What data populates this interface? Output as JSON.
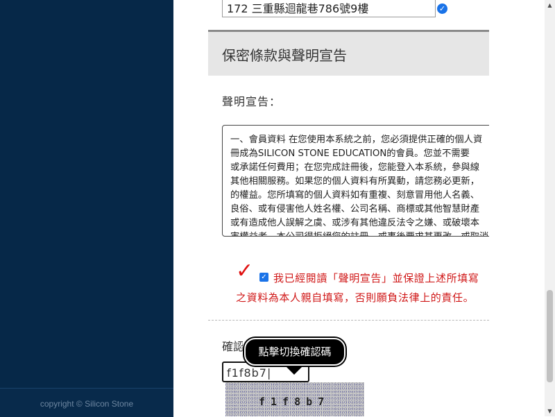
{
  "sidebar": {
    "copyright": "copyright © Silicon Stone"
  },
  "form": {
    "address_value": "172 三重縣迴龍巷786號9樓",
    "address_verified_icon": "check-circle-icon"
  },
  "section": {
    "title": "保密條款與聲明宣告",
    "declaration_label": "聲明宣告："
  },
  "terms": {
    "text_lines": [
      "一、會員資料 在您使用本系統之前，您必須提供正確的個人資",
      "冊成為SILICON STONE EDUCATION的會員。您並不需要",
      "或承諾任何費用；在您完成註冊後，您能登入本系統，參與線",
      "其他相關服務。如果您的個人資料有所異動，請您務必更新，",
      "的權益。您所填寫的個人資料如有重複、刻意冒用他人名義、",
      "良俗、或有侵害他人姓名權、公司名稱、商標或其他智慧財產",
      "或有造成他人誤解之虞、或涉有其他違反法令之嫌、或破壞本",
      "害權益者，本公司得拒絕您的註冊，或事後要求其更改，或取消"
    ]
  },
  "agreement": {
    "checked": true,
    "mark_icon": "red-checkmark-icon",
    "line1": "我已經閱讀「聲明宣告」並保證上述所填寫",
    "line2": "之資料為本人親自填寫，否則願負法律上的責任。"
  },
  "captcha": {
    "label": "確認碼",
    "input_value": "f1f8b7|",
    "image_text": "f1f8b7",
    "tooltip": "點擊切換確認碼"
  },
  "colors": {
    "sidebar_bg": "#062848",
    "accent_red": "#d01818",
    "accent_blue": "#1a73e8",
    "section_bg": "#e6e6e6"
  }
}
